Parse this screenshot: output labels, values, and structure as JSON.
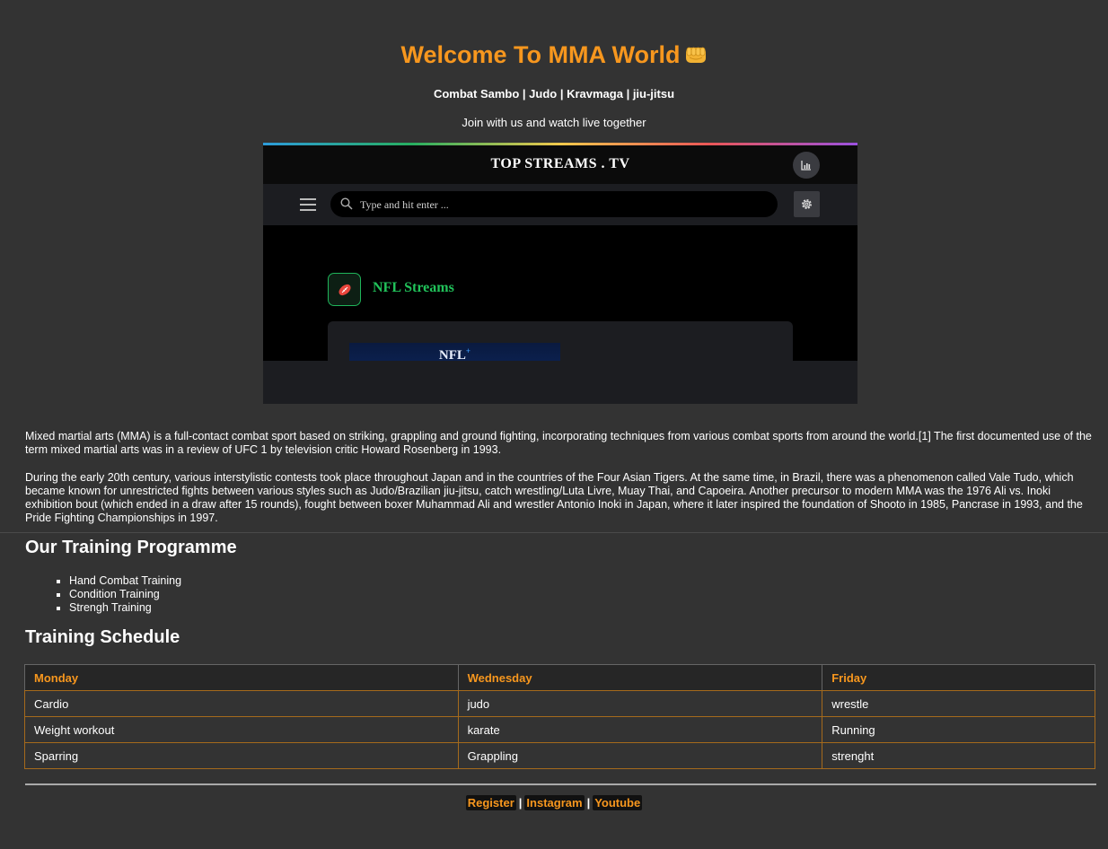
{
  "page": {
    "title": "Welcome To MMA World",
    "title_icon": "oncoming-fist-icon",
    "subtitle": "Combat Sambo | Judo | Kravmaga | jiu-jitsu",
    "tagline": "Join with us and watch live together"
  },
  "colors": {
    "accent": "#f7971e",
    "background": "#333333",
    "stream_green": "#21c25a"
  },
  "embed": {
    "brand": "TOP STREAMS . TV",
    "search_placeholder": "Type and hit enter ...",
    "section_title": "NFL Streams",
    "thumb_text": "NFL",
    "thumb_sup": "+",
    "icons": [
      "stats-icon",
      "hamburger-menu-icon",
      "search-icon",
      "gear-icon",
      "football-icon"
    ]
  },
  "article": {
    "p1": "Mixed martial arts (MMA) is a full-contact combat sport based on striking, grappling and ground fighting, incorporating techniques from various combat sports from around the world.[1] The first documented use of the term mixed martial arts was in a review of UFC 1 by television critic Howard Rosenberg in 1993.",
    "p2": "During the early 20th century, various interstylistic contests took place throughout Japan and in the countries of the Four Asian Tigers. At the same time, in Brazil, there was a phenomenon called Vale Tudo, which became known for unrestricted fights between various styles such as Judo/Brazilian jiu-jitsu, catch wrestling/Luta Livre, Muay Thai, and Capoeira. Another precursor to modern MMA was the 1976 Ali vs. Inoki exhibition bout (which ended in a draw after 15 rounds), fought between boxer Muhammad Ali and wrestler Antonio Inoki in Japan, where it later inspired the foundation of Shooto in 1985, Pancrase in 1993, and the Pride Fighting Championships in 1997."
  },
  "training": {
    "heading": "Our Training Programme",
    "items": [
      "Hand Combat Training",
      "Condition Training",
      "Strengh Training"
    ]
  },
  "schedule": {
    "heading": "Training Schedule",
    "columns": [
      "Monday",
      "Wednesday",
      "Friday"
    ],
    "rows": [
      [
        "Cardio",
        "judo",
        "wrestle"
      ],
      [
        "Weight workout",
        "karate",
        "Running"
      ],
      [
        "Sparring",
        "Grappling",
        "strenght"
      ]
    ]
  },
  "footer": {
    "links": [
      "Register",
      "Instagram",
      "Youtube"
    ],
    "separator": "|"
  }
}
